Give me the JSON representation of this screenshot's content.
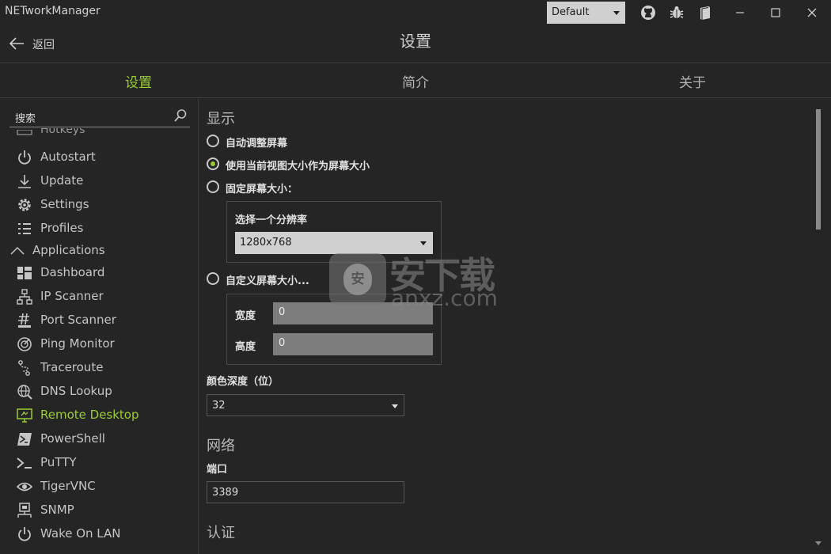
{
  "titlebar": {
    "app_title": "NETworkManager",
    "theme_value": "Default",
    "icons": [
      "github-icon",
      "bug-icon",
      "book-icon"
    ],
    "window_controls": [
      "minimize-icon",
      "maximize-icon",
      "close-icon"
    ]
  },
  "header": {
    "back_label": "返回",
    "page_title": "设置"
  },
  "tabs": [
    {
      "label": "设置",
      "active": true
    },
    {
      "label": "简介",
      "active": false
    },
    {
      "label": "关于",
      "active": false
    }
  ],
  "sidebar": {
    "search_placeholder": "搜索",
    "partial_item": "Hotkeys",
    "items": [
      {
        "label": "Autostart",
        "icon": "power-icon"
      },
      {
        "label": "Update",
        "icon": "download-icon"
      },
      {
        "label": "Settings",
        "icon": "gear-icon"
      },
      {
        "label": "Profiles",
        "icon": "list-icon"
      },
      {
        "label": "Applications",
        "icon": "chevron-up-icon"
      },
      {
        "label": "Dashboard",
        "icon": "dashboard-icon"
      },
      {
        "label": "IP Scanner",
        "icon": "network-icon"
      },
      {
        "label": "Port Scanner",
        "icon": "hash-icon"
      },
      {
        "label": "Ping Monitor",
        "icon": "radar-icon"
      },
      {
        "label": "Traceroute",
        "icon": "route-icon"
      },
      {
        "label": "DNS Lookup",
        "icon": "globe-search-icon"
      },
      {
        "label": "Remote Desktop",
        "icon": "remote-desktop-icon",
        "active": true
      },
      {
        "label": "PowerShell",
        "icon": "powershell-icon"
      },
      {
        "label": "PuTTY",
        "icon": "terminal-icon"
      },
      {
        "label": "TigerVNC",
        "icon": "eye-icon"
      },
      {
        "label": "SNMP",
        "icon": "snmp-icon"
      },
      {
        "label": "Wake On LAN",
        "icon": "power-icon"
      }
    ]
  },
  "display": {
    "heading": "显示",
    "options": [
      {
        "label": "自动调整屏幕",
        "selected": false
      },
      {
        "label": "使用当前视图大小作为屏幕大小",
        "selected": true
      },
      {
        "label": "固定屏幕大小：",
        "selected": false
      }
    ],
    "resolution_label": "选择一个分辨率",
    "resolution_value": "1280x768",
    "custom_option": {
      "label": "自定义屏幕大小...",
      "selected": false
    },
    "width_label": "宽度",
    "width_value": "0",
    "height_label": "高度",
    "height_value": "0",
    "color_depth_label": "颜色深度（位）",
    "color_depth_value": "32"
  },
  "network": {
    "heading": "网络",
    "port_label": "端口",
    "port_value": "3389"
  },
  "auth": {
    "heading": "认证"
  },
  "watermark": {
    "shield_char": "安",
    "text_cn": "安下载",
    "text_en": "anxz.com"
  },
  "colors": {
    "accent": "#9acd32",
    "background": "#252525",
    "text": "#c9c9c9"
  }
}
